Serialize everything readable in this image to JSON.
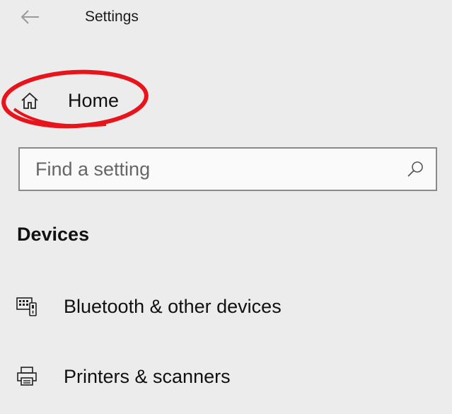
{
  "window": {
    "title": "Settings"
  },
  "nav": {
    "back_icon": "back-arrow-icon",
    "home": {
      "label": "Home",
      "icon": "home-icon"
    }
  },
  "annotation": {
    "highlight_color": "#e8141b"
  },
  "search": {
    "placeholder": "Find a setting",
    "value": "",
    "icon": "search-icon"
  },
  "section": {
    "heading": "Devices",
    "items": [
      {
        "label": "Bluetooth & other devices",
        "icon": "keyboard-device-icon"
      },
      {
        "label": "Printers & scanners",
        "icon": "printer-icon"
      }
    ]
  }
}
